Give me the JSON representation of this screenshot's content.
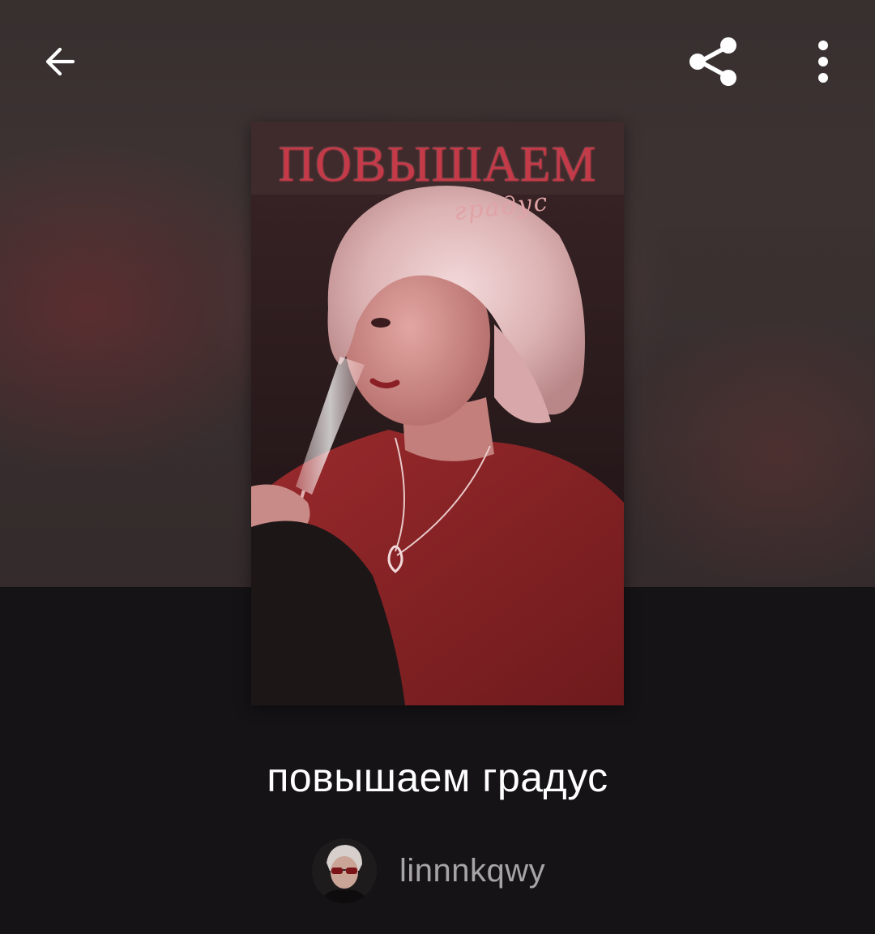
{
  "header": {
    "back_icon": "arrow-left-icon",
    "share_icon": "share-icon",
    "more_icon": "more-vertical-icon"
  },
  "cover": {
    "title": "ПОВЫШАЕМ",
    "subtitle": "градус"
  },
  "book": {
    "title": "повышаем градус",
    "author": "linnnkqwy"
  },
  "colors": {
    "background": "#151316",
    "text_primary": "#ffffff",
    "text_secondary": "#a7a4a7",
    "cover_title": "#c43a48"
  }
}
